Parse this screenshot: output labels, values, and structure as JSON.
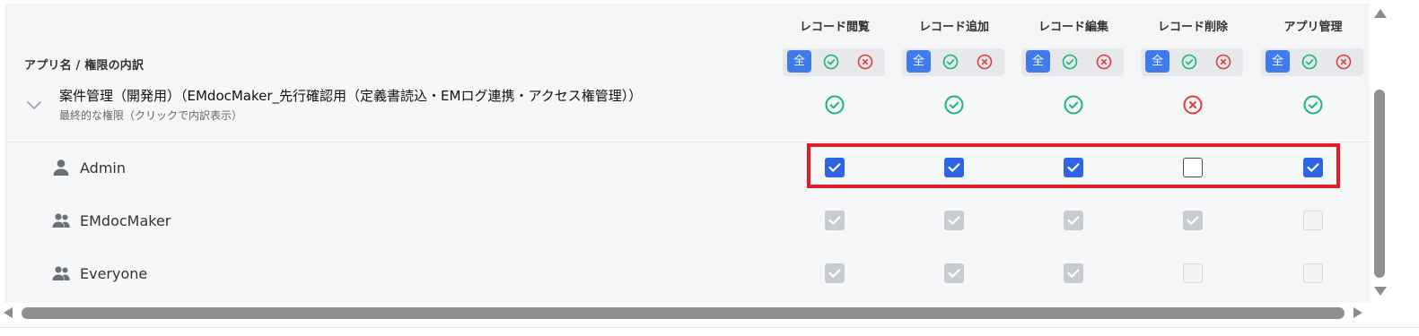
{
  "header": {
    "title": "アプリ名 / 権限の内訳",
    "columns": [
      {
        "label": "レコード閲覧",
        "all_label": "全"
      },
      {
        "label": "レコード追加",
        "all_label": "全"
      },
      {
        "label": "レコード編集",
        "all_label": "全"
      },
      {
        "label": "レコード削除",
        "all_label": "全"
      },
      {
        "label": "アプリ管理",
        "all_label": "全"
      }
    ]
  },
  "app": {
    "name": "案件管理（開発用）（EMdocMaker_先行確認用（定義書読込・EMログ連携・アクセス権管理））",
    "subtitle": "最終的な権限（クリックで内訳表示）",
    "final_permissions": [
      "ok",
      "ok",
      "ok",
      "ng",
      "ok"
    ]
  },
  "users": [
    {
      "name": "Admin",
      "icon": "user-icon",
      "editable": true,
      "permissions": [
        true,
        true,
        true,
        false,
        true
      ]
    },
    {
      "name": "EMdocMaker",
      "icon": "group-icon",
      "editable": false,
      "permissions": [
        true,
        true,
        true,
        true,
        false
      ]
    },
    {
      "name": "Everyone",
      "icon": "group-icon",
      "editable": false,
      "permissions": [
        true,
        true,
        true,
        false,
        false
      ]
    }
  ],
  "colors": {
    "ok": "#19b577",
    "ng": "#e23a3a",
    "accent": "#2f64e6",
    "highlight": "#e51c23"
  }
}
